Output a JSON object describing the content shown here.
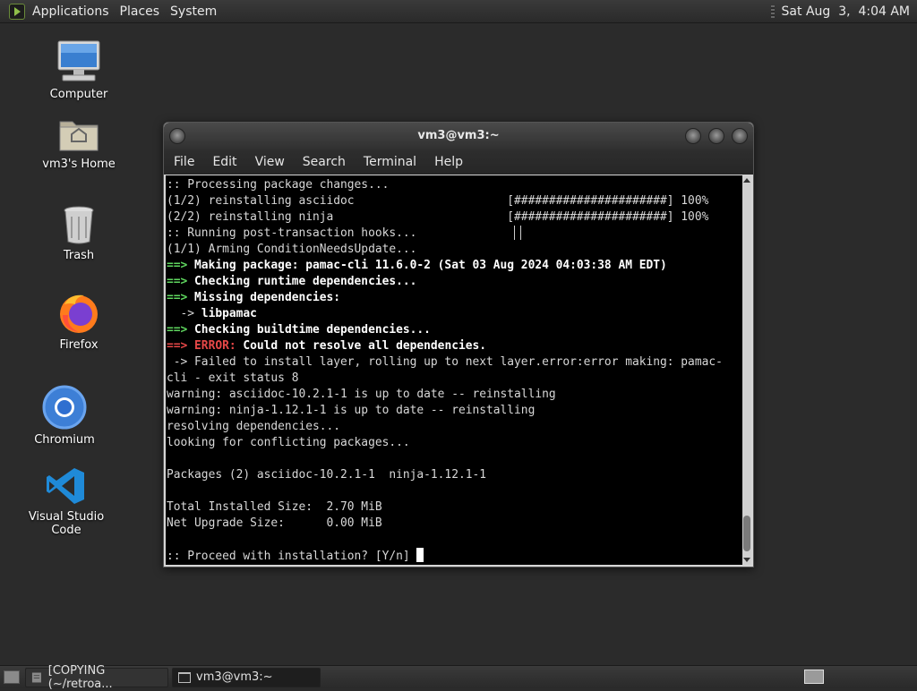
{
  "top_panel": {
    "menus": [
      "Applications",
      "Places",
      "System"
    ],
    "clock": "Sat Aug  3,  4:04 AM"
  },
  "desktop": {
    "icons": [
      {
        "label": "Computer",
        "icon": "computer-icon"
      },
      {
        "label": "vm3's Home",
        "icon": "home-folder-icon"
      },
      {
        "label": "Trash",
        "icon": "trash-icon"
      },
      {
        "label": "Firefox",
        "icon": "firefox-icon"
      },
      {
        "label": "Chromium",
        "icon": "chromium-icon"
      },
      {
        "label": "Visual Studio Code",
        "icon": "vscode-icon"
      }
    ]
  },
  "window": {
    "title": "vm3@vm3:~",
    "menu": [
      "File",
      "Edit",
      "View",
      "Search",
      "Terminal",
      "Help"
    ]
  },
  "terminal": {
    "lines": [
      [
        {
          "t": ":: Processing package changes..."
        }
      ],
      [
        {
          "t": "(1/2) reinstalling asciidoc                      [######################] 100%"
        }
      ],
      [
        {
          "t": "(2/2) reinstalling ninja                         [######################] 100%"
        }
      ],
      [
        {
          "t": ":: Running post-transaction hooks..."
        }
      ],
      [
        {
          "t": "(1/1) Arming ConditionNeedsUpdate..."
        }
      ],
      [
        {
          "t": "==> ",
          "s": "g"
        },
        {
          "t": "Making package: pamac-cli 11.6.0-2 (Sat 03 Aug 2024 04:03:38 AM EDT)",
          "s": "b"
        }
      ],
      [
        {
          "t": "==> ",
          "s": "g"
        },
        {
          "t": "Checking runtime dependencies...",
          "s": "b"
        }
      ],
      [
        {
          "t": "==> ",
          "s": "g"
        },
        {
          "t": "Missing dependencies:",
          "s": "b"
        }
      ],
      [
        {
          "t": "  -> ",
          "s": ""
        },
        {
          "t": "libpamac",
          "s": "b"
        }
      ],
      [
        {
          "t": "==> ",
          "s": "g"
        },
        {
          "t": "Checking buildtime dependencies...",
          "s": "b"
        }
      ],
      [
        {
          "t": "==> ERROR: ",
          "s": "r"
        },
        {
          "t": "Could not resolve all dependencies.",
          "s": "b"
        }
      ],
      [
        {
          "t": " -> Failed to install layer, rolling up to next layer.error:error making: pamac-"
        }
      ],
      [
        {
          "t": "cli - exit status 8"
        }
      ],
      [
        {
          "t": "warning: asciidoc-10.2.1-1 is up to date -- reinstalling"
        }
      ],
      [
        {
          "t": "warning: ninja-1.12.1-1 is up to date -- reinstalling"
        }
      ],
      [
        {
          "t": "resolving dependencies..."
        }
      ],
      [
        {
          "t": "looking for conflicting packages..."
        }
      ],
      [
        {
          "t": ""
        }
      ],
      [
        {
          "t": "Packages (2) asciidoc-10.2.1-1  ninja-1.12.1-1"
        }
      ],
      [
        {
          "t": ""
        }
      ],
      [
        {
          "t": "Total Installed Size:  2.70 MiB"
        }
      ],
      [
        {
          "t": "Net Upgrade Size:      0.00 MiB"
        }
      ],
      [
        {
          "t": ""
        }
      ],
      [
        {
          "t": ":: Proceed with installation? [Y/n] "
        }
      ]
    ]
  },
  "taskbar": {
    "tasks": [
      {
        "label": "[COPYING (~/retroa...",
        "icon": "text-editor-icon",
        "active": false
      },
      {
        "label": "vm3@vm3:~",
        "icon": "terminal-icon",
        "active": true
      }
    ]
  }
}
